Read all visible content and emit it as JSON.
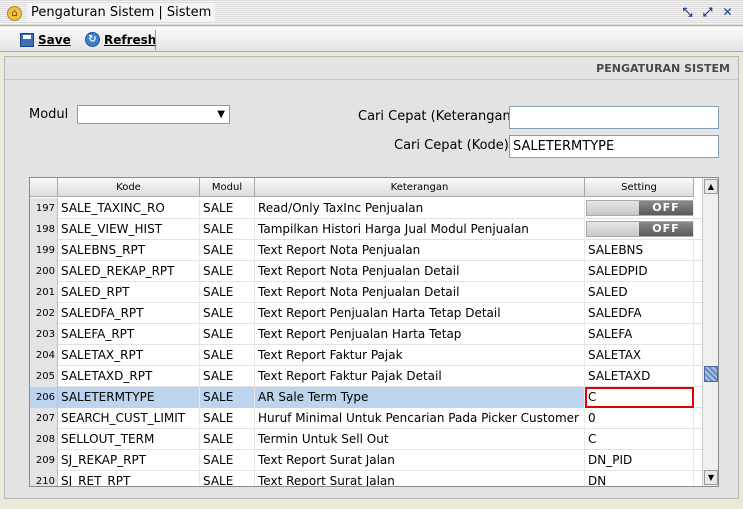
{
  "window": {
    "title": "Pengaturan Sistem | Sistem"
  },
  "toolbar": {
    "save_label": "Save",
    "refresh_label": "Refresh"
  },
  "header": {
    "section_title": "PENGATURAN SISTEM"
  },
  "filters": {
    "modul_label": "Modul",
    "modul_value": "",
    "cari_keterangan_label": "Cari Cepat (Keterangan)",
    "cari_keterangan_value": "",
    "cari_kode_label": "Cari Cepat (Kode)",
    "cari_kode_value": "SALETERMTYPE"
  },
  "table": {
    "columns": [
      "",
      "Kode",
      "Modul",
      "Keterangan",
      "Setting"
    ],
    "rows": [
      {
        "no": "197",
        "kode": "SALE_TAXINC_RO",
        "modul": "SALE",
        "keterangan": "Read/Only TaxInc Penjualan",
        "setting": "OFF",
        "toggle": true
      },
      {
        "no": "198",
        "kode": "SALE_VIEW_HIST",
        "modul": "SALE",
        "keterangan": "Tampilkan Histori Harga Jual Modul Penjualan",
        "setting": "OFF",
        "toggle": true
      },
      {
        "no": "199",
        "kode": "SALEBNS_RPT",
        "modul": "SALE",
        "keterangan": "Text Report Nota Penjualan",
        "setting": "SALEBNS"
      },
      {
        "no": "200",
        "kode": "SALED_REKAP_RPT",
        "modul": "SALE",
        "keterangan": "Text Report Nota Penjualan Detail",
        "setting": "SALEDPID"
      },
      {
        "no": "201",
        "kode": "SALED_RPT",
        "modul": "SALE",
        "keterangan": "Text Report Nota Penjualan Detail",
        "setting": "SALED"
      },
      {
        "no": "202",
        "kode": "SALEDFA_RPT",
        "modul": "SALE",
        "keterangan": "Text Report Penjualan Harta Tetap Detail",
        "setting": "SALEDFA"
      },
      {
        "no": "203",
        "kode": "SALEFA_RPT",
        "modul": "SALE",
        "keterangan": "Text Report Penjualan Harta Tetap",
        "setting": "SALEFA"
      },
      {
        "no": "204",
        "kode": "SALETAX_RPT",
        "modul": "SALE",
        "keterangan": "Text Report Faktur Pajak",
        "setting": "SALETAX"
      },
      {
        "no": "205",
        "kode": "SALETAXD_RPT",
        "modul": "SALE",
        "keterangan": "Text Report Faktur Pajak Detail",
        "setting": "SALETAXD"
      },
      {
        "no": "206",
        "kode": "SALETERMTYPE",
        "modul": "SALE",
        "keterangan": "AR Sale Term Type",
        "setting": "C",
        "selected": true
      },
      {
        "no": "207",
        "kode": "SEARCH_CUST_LIMIT",
        "modul": "SALE",
        "keterangan": "Huruf Minimal Untuk Pencarian Pada Picker Customer",
        "setting": "0"
      },
      {
        "no": "208",
        "kode": "SELLOUT_TERM",
        "modul": "SALE",
        "keterangan": "Termin Untuk Sell Out",
        "setting": "C"
      },
      {
        "no": "209",
        "kode": "SJ_REKAP_RPT",
        "modul": "SALE",
        "keterangan": "Text Report Surat Jalan",
        "setting": "DN_PID"
      },
      {
        "no": "210",
        "kode": "SJ_RET_RPT",
        "modul": "SALE",
        "keterangan": "Text Report Surat Jalan",
        "setting": "DN"
      }
    ]
  },
  "colors": {
    "selected_row": "#bcd4ee",
    "active_cell_border": "#e00000"
  }
}
